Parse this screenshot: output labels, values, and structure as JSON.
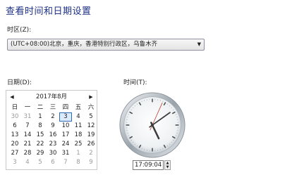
{
  "title": "查看时间和日期设置",
  "timezone": {
    "label": "时区(Z):",
    "value": "(UTC+08:00)北京，重庆，香港特别行政区，乌鲁木齐"
  },
  "date": {
    "label": "日期(D):",
    "calendar": {
      "month_title": "2017年8月",
      "prev": "◀",
      "next": "▶",
      "weekdays": [
        "日",
        "一",
        "二",
        "三",
        "四",
        "五",
        "六"
      ],
      "days": [
        [
          "30",
          "31",
          "1",
          "2",
          "3",
          "4",
          "5"
        ],
        [
          "6",
          "7",
          "8",
          "9",
          "10",
          "11",
          "12"
        ],
        [
          "13",
          "14",
          "15",
          "16",
          "17",
          "18",
          "19"
        ],
        [
          "20",
          "21",
          "22",
          "23",
          "24",
          "25",
          "26"
        ],
        [
          "27",
          "28",
          "29",
          "30",
          "31",
          "1",
          "2"
        ],
        [
          "3",
          "4",
          "5",
          "6",
          "7",
          "8",
          "9"
        ]
      ],
      "selected": "3"
    }
  },
  "time": {
    "label": "时间(T):",
    "value": "17:09:04",
    "clock": {
      "hour": 17,
      "minute": 9,
      "second": 4
    }
  }
}
